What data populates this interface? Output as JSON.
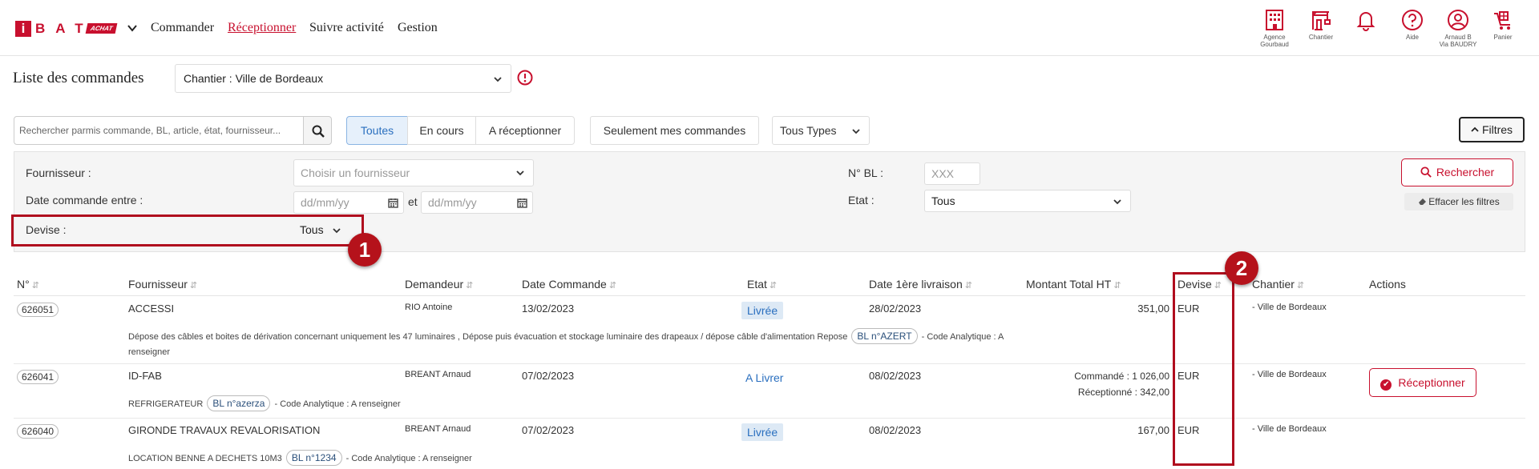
{
  "header": {
    "logo": {
      "mark": "i",
      "brand": "BAT",
      "tag": "ACHAT"
    },
    "nav": [
      {
        "label": "Commander",
        "active": false
      },
      {
        "label": "Réceptionner",
        "active": true
      },
      {
        "label": "Suivre activité",
        "active": false
      },
      {
        "label": "Gestion",
        "active": false
      }
    ],
    "icons": [
      {
        "icon": "building-icon",
        "label": "Agence",
        "label2": "Gourbaud"
      },
      {
        "icon": "crane-icon",
        "label": "Chantier",
        "label2": ""
      },
      {
        "icon": "bell-icon",
        "label": "",
        "label2": ""
      },
      {
        "icon": "help-icon",
        "label": "Aide",
        "label2": ""
      },
      {
        "icon": "user-icon",
        "label": "Arnaud B",
        "label2": "Via BAUDRY"
      },
      {
        "icon": "cart-icon",
        "label": "Panier",
        "label2": ""
      }
    ]
  },
  "title_row": {
    "title": "Liste des commandes",
    "chantier_select": "Chantier : Ville de Bordeaux"
  },
  "toolbar": {
    "search_placeholder": "Rechercher parmis commande, BL, article, état, fournisseur...",
    "segments": [
      "Toutes",
      "En cours",
      "A réceptionner"
    ],
    "active_segment": "Toutes",
    "mine_button": "Seulement mes commandes",
    "types_select": "Tous Types",
    "filters_button": "Filtres"
  },
  "filters": {
    "fournisseur_label": "Fournisseur :",
    "fournisseur_placeholder": "Choisir un fournisseur",
    "date_label": "Date commande entre :",
    "date_from_placeholder": "dd/mm/yy",
    "date_and": "et",
    "date_to_placeholder": "dd/mm/yy",
    "devise_label": "Devise :",
    "devise_value": "Tous",
    "bl_label": "N° BL :",
    "bl_placeholder": "XXX",
    "etat_label": "Etat :",
    "etat_value": "Tous",
    "search_button": "Rechercher",
    "clear_button": "Effacer les filtres"
  },
  "annotations": [
    "1",
    "2"
  ],
  "table": {
    "columns": [
      "N°",
      "Fournisseur",
      "Demandeur",
      "Date Commande",
      "Etat",
      "Date 1ère livraison",
      "Montant Total HT",
      "Devise",
      "Chantier",
      "Actions"
    ],
    "rows": [
      {
        "no": "626051",
        "fournisseur": "ACCESSI",
        "demandeur": "RIO Antoine",
        "date_commande": "13/02/2023",
        "etat": "Livrée",
        "date_livraison": "28/02/2023",
        "montant": "351,00",
        "devise": "EUR",
        "chantier": "- Ville de Bordeaux",
        "desc_before": "Dépose des câbles et boites de dérivation concernant uniquement les 47 luminaires , Dépose puis évacuation et stockage luminaire des drapeaux / dépose câble d'alimentation Repose",
        "bl": "BL n°AZERT",
        "desc_after": "- Code Analytique : A",
        "desc_line2": "renseigner"
      },
      {
        "no": "626041",
        "fournisseur": "ID-FAB",
        "demandeur": "BREANT Arnaud",
        "date_commande": "07/02/2023",
        "etat": "A Livrer",
        "date_livraison": "08/02/2023",
        "montant_commande": "Commandé : 1 026,00",
        "montant_recu": "Réceptionné : 342,00",
        "devise": "EUR",
        "chantier": "- Ville de Bordeaux",
        "desc_before": "REFRIGERATEUR",
        "bl": "BL n°azerza",
        "desc_after": "- Code Analytique : A renseigner",
        "action": "Réceptionner"
      },
      {
        "no": "626040",
        "fournisseur": "GIRONDE TRAVAUX REVALORISATION",
        "demandeur": "BREANT Arnaud",
        "date_commande": "07/02/2023",
        "etat": "Livrée",
        "date_livraison": "08/02/2023",
        "montant": "167,00",
        "devise": "EUR",
        "chantier": "- Ville de Bordeaux",
        "desc_before": "LOCATION BENNE A DECHETS 10M3",
        "bl": "BL n°1234",
        "desc_after": "- Code Analytique : A renseigner"
      }
    ]
  },
  "colors": {
    "brand_red": "#c8102e",
    "annotation_red": "#b5121b",
    "link_blue": "#2a6fbf"
  }
}
